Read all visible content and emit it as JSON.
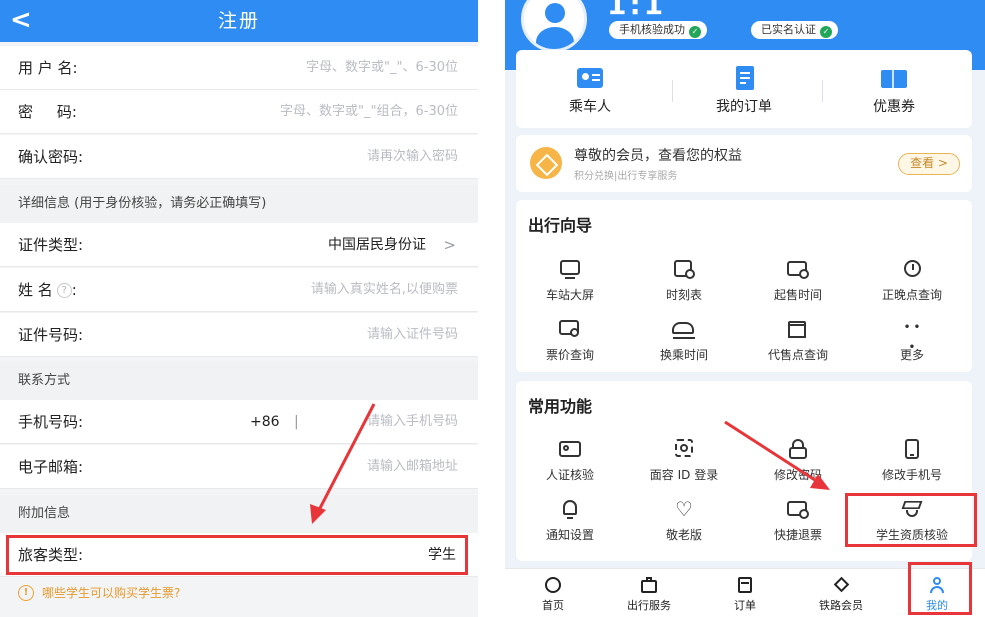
{
  "left": {
    "header": {
      "back": "<",
      "title": "注册"
    },
    "rows": [
      {
        "label": "用 户 名:",
        "placeholder": "字母、数字或\"_\"、6-30位"
      },
      {
        "label": "密     码:",
        "placeholder": "字母、数字或\"_\"组合，6-30位"
      },
      {
        "label": "确认密码:",
        "placeholder": "请再次输入密码"
      }
    ],
    "section_detail": "详细信息 (用于身份核验，请务必正确填写)",
    "id_type": {
      "label": "证件类型:",
      "value": "中国居民身份证",
      "chevron": ">"
    },
    "name": {
      "label": "姓 名",
      "colon": ":",
      "help": "?",
      "placeholder": "请输入真实姓名,以便购票"
    },
    "id_number": {
      "label": "证件号码:",
      "placeholder": "请输入证件号码"
    },
    "section_contact": "联系方式",
    "phone": {
      "label": "手机号码:",
      "prefix": "+86",
      "sep": "|",
      "placeholder": "请输入手机号码"
    },
    "email": {
      "label": "电子邮箱:",
      "placeholder": "请输入邮箱地址"
    },
    "section_extra": "附加信息",
    "passenger": {
      "label": "旅客类型:",
      "value": "学生"
    },
    "notice": {
      "icon": "!",
      "text": "哪些学生可以购买学生票?"
    }
  },
  "right": {
    "username": "1:1",
    "badges": [
      "手机核验成功",
      "已实名认证"
    ],
    "badge_ok": "✓",
    "quick": [
      {
        "label": "乘车人",
        "icon": "id-card-icon"
      },
      {
        "label": "我的订单",
        "icon": "order-icon"
      },
      {
        "label": "优惠券",
        "icon": "coupon-icon"
      }
    ],
    "vip": {
      "title": "尊敬的会员，查看您的权益",
      "sub": "积分兑换|出行专享服务",
      "button": "查看 >"
    },
    "guide": {
      "title": "出行向导",
      "items": [
        "车站大屏",
        "时刻表",
        "起售时间",
        "正晚点查询",
        "票价查询",
        "换乘时间",
        "代售点查询",
        "更多"
      ],
      "more_glyph": "• • •"
    },
    "common": {
      "title": "常用功能",
      "items": [
        "人证核验",
        "面容 ID 登录",
        "修改密码",
        "修改手机号",
        "通知设置",
        "敬老版",
        "快捷退票",
        "学生资质核验"
      ]
    },
    "tabs": [
      "首页",
      "出行服务",
      "订单",
      "铁路会员",
      "我的"
    ],
    "accent": "#2f8cf3",
    "highlight": "#e8353a"
  }
}
